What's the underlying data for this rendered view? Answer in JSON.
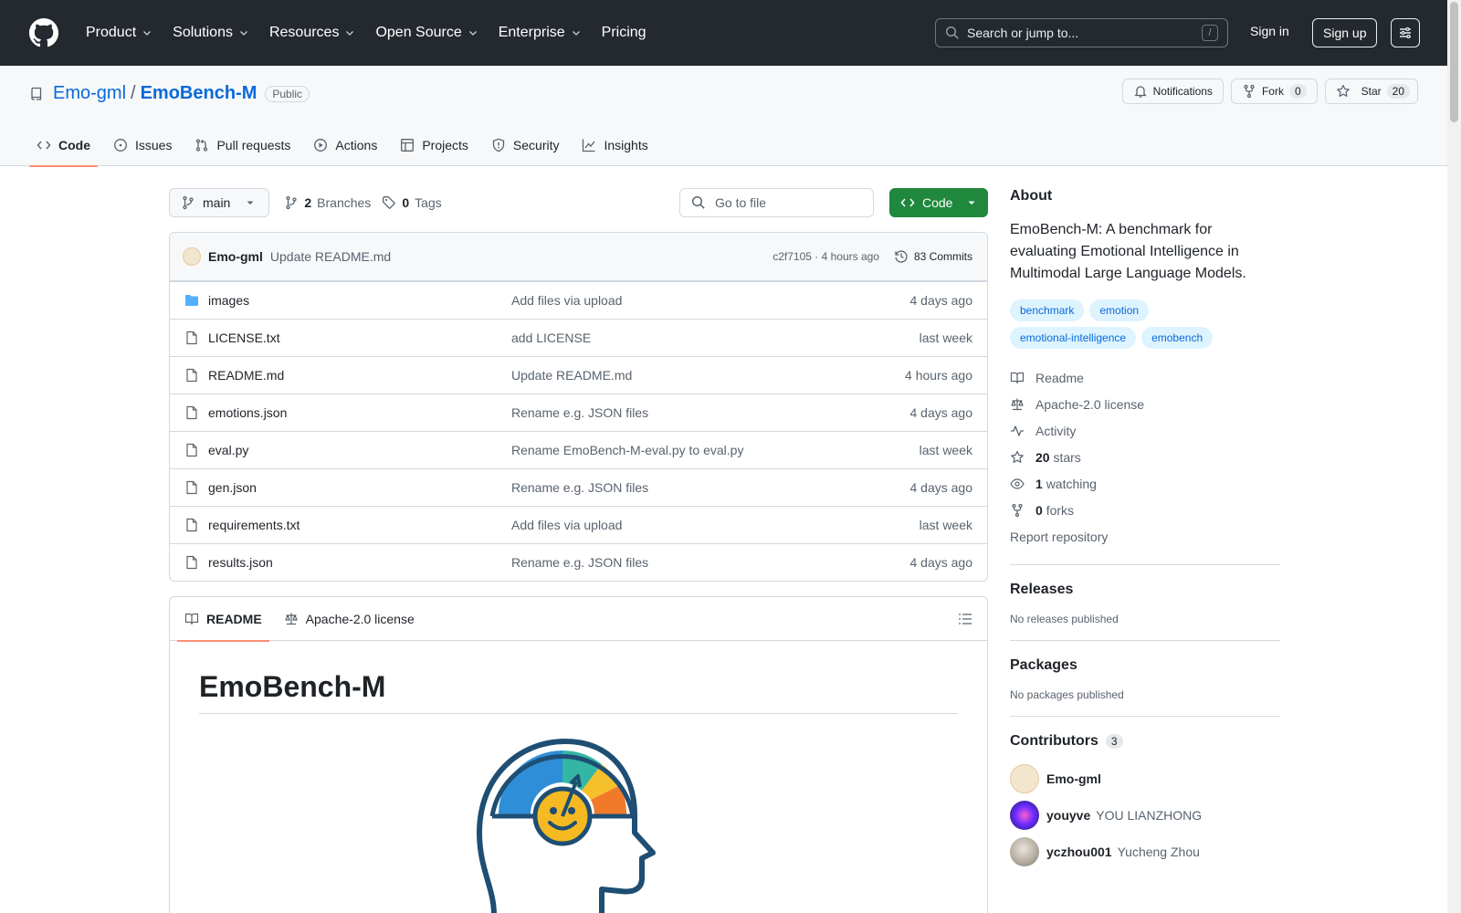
{
  "header": {
    "nav": [
      "Product",
      "Solutions",
      "Resources",
      "Open Source",
      "Enterprise",
      "Pricing"
    ],
    "search_placeholder": "Search or jump to...",
    "search_key": "/",
    "sign_in": "Sign in",
    "sign_up": "Sign up"
  },
  "repo": {
    "owner": "Emo-gml",
    "separator": "/",
    "name": "EmoBench-M",
    "visibility": "Public",
    "notifications": "Notifications",
    "fork": "Fork",
    "fork_count": "0",
    "star": "Star",
    "star_count": "20",
    "tabs": [
      "Code",
      "Issues",
      "Pull requests",
      "Actions",
      "Projects",
      "Security",
      "Insights"
    ]
  },
  "toolbar": {
    "branch": "main",
    "branches_count": "2",
    "branches_label": "Branches",
    "tags_count": "0",
    "tags_label": "Tags",
    "goto_placeholder": "Go to file",
    "code_button": "Code"
  },
  "commit": {
    "author": "Emo-gml",
    "message": "Update README.md",
    "hash_time": "c2f7105 · 4 hours ago",
    "commits": "83 Commits"
  },
  "files": [
    {
      "name": "images",
      "type": "folder",
      "commit": "Add files via upload",
      "age": "4 days ago"
    },
    {
      "name": "LICENSE.txt",
      "type": "file",
      "commit": "add LICENSE",
      "age": "last week"
    },
    {
      "name": "README.md",
      "type": "file",
      "commit": "Update README.md",
      "age": "4 hours ago"
    },
    {
      "name": "emotions.json",
      "type": "file",
      "commit": "Rename e.g. JSON files",
      "age": "4 days ago"
    },
    {
      "name": "eval.py",
      "type": "file",
      "commit": "Rename EmoBench-M-eval.py to eval.py",
      "age": "last week"
    },
    {
      "name": "gen.json",
      "type": "file",
      "commit": "Rename e.g. JSON files",
      "age": "4 days ago"
    },
    {
      "name": "requirements.txt",
      "type": "file",
      "commit": "Add files via upload",
      "age": "last week"
    },
    {
      "name": "results.json",
      "type": "file",
      "commit": "Rename e.g. JSON files",
      "age": "4 days ago"
    }
  ],
  "readme": {
    "tab_readme": "README",
    "tab_license": "Apache-2.0 license",
    "heading": "EmoBench-M"
  },
  "about": {
    "title": "About",
    "description": "EmoBench-M: A benchmark for evaluating Emotional Intelligence in Multimodal Large Language Models.",
    "topics": [
      "benchmark",
      "emotion",
      "emotional-intelligence",
      "emobench"
    ],
    "readme": "Readme",
    "license": "Apache-2.0 license",
    "activity": "Activity",
    "stars_count": "20",
    "stars_label": "stars",
    "watching_count": "1",
    "watching_label": "watching",
    "forks_count": "0",
    "forks_label": "forks",
    "report": "Report repository"
  },
  "releases": {
    "title": "Releases",
    "empty": "No releases published"
  },
  "packages": {
    "title": "Packages",
    "empty": "No packages published"
  },
  "contributors": {
    "title": "Contributors",
    "count": "3",
    "list": [
      {
        "login": "Emo-gml",
        "name": ""
      },
      {
        "login": "youyve",
        "name": "YOU LIANZHONG"
      },
      {
        "login": "yczhou001",
        "name": "Yucheng Zhou"
      }
    ]
  },
  "colors": {
    "header_bg": "#24292f",
    "link": "#0969da",
    "code_button": "#1f883d",
    "active_tab_underline": "#fd8c73"
  }
}
